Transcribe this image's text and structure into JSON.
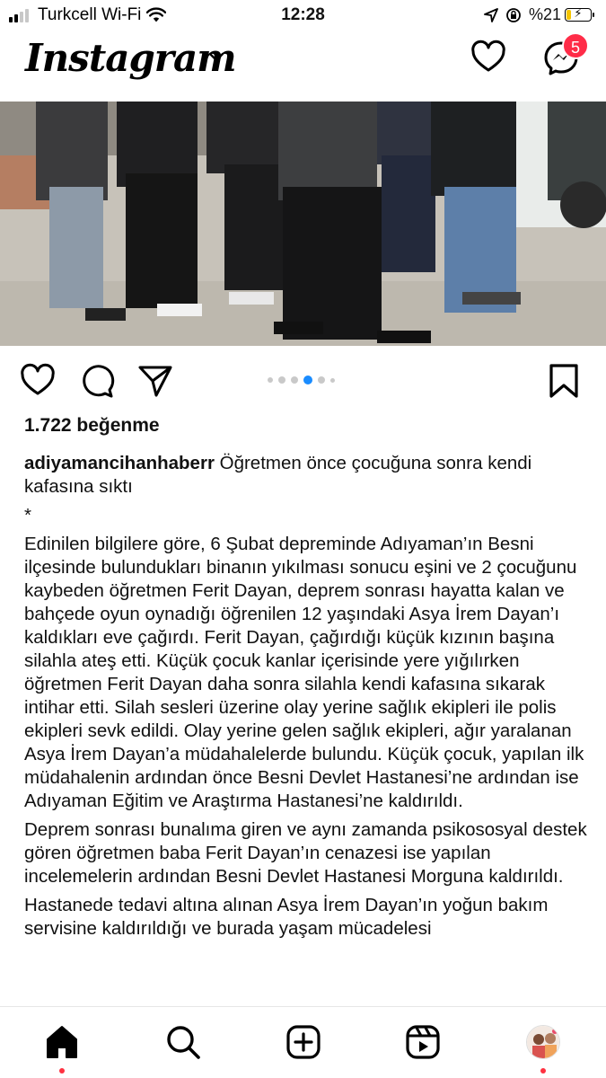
{
  "status_bar": {
    "carrier": "Turkcell Wi-Fi",
    "time": "12:28",
    "battery_label": "%21",
    "battery_level": 0.21
  },
  "header": {
    "logo": "Instagram",
    "messages_badge": "5"
  },
  "post": {
    "carousel": {
      "count": 6,
      "active_index": 3
    },
    "likes": "1.722 beğenme",
    "username": "adiyamancihanhaberr",
    "title": "Öğretmen önce çocuğuna sonra kendi kafasına sıktı",
    "separator": "*",
    "paragraphs": [
      "Edinilen bilgilere göre, 6 Şubat depreminde Adıyaman’ın Besni ilçesinde bulundukları binanın yıkılması sonucu eşini ve 2 çocuğunu kaybeden öğretmen Ferit Dayan, deprem sonrası hayatta kalan ve bahçede oyun oynadığı öğrenilen 12 yaşındaki Asya İrem Dayan’ı kaldıkları eve çağırdı. Ferit Dayan, çağırdığı küçük kızının başına silahla ateş etti. Küçük çocuk kanlar içerisinde yere yığılırken öğretmen Ferit Dayan daha sonra silahla kendi kafasına sıkarak intihar etti. Silah sesleri üzerine olay yerine sağlık ekipleri ile polis ekipleri sevk edildi. Olay yerine gelen sağlık ekipleri, ağır yaralanan Asya İrem Dayan’a müdahalelerde bulundu. Küçük çocuk, yapılan ilk müdahalenin ardından önce Besni Devlet Hastanesi’ne ardından ise Adıyaman Eğitim ve Araştırma Hastanesi’ne kaldırıldı.",
      "Deprem sonrası bunalıma giren ve aynı zamanda psikososyal destek gören öğretmen baba Ferit Dayan’ın cenazesi ise yapılan incelemelerin ardından Besni Devlet Hastanesi Morguna kaldırıldı.",
      "Hastanede tedavi altına alınan Asya İrem Dayan’ın yoğun bakım servisine kaldırıldığı ve burada yaşam mücadelesi"
    ]
  },
  "colors": {
    "badge": "#ff2c48",
    "active_dot": "#1a8cff",
    "notification_dot": "#ff3040"
  },
  "icons": [
    "heart-icon",
    "messenger-icon",
    "comment-icon",
    "share-icon",
    "bookmark-icon",
    "home-icon",
    "search-icon",
    "create-icon",
    "reels-icon"
  ]
}
